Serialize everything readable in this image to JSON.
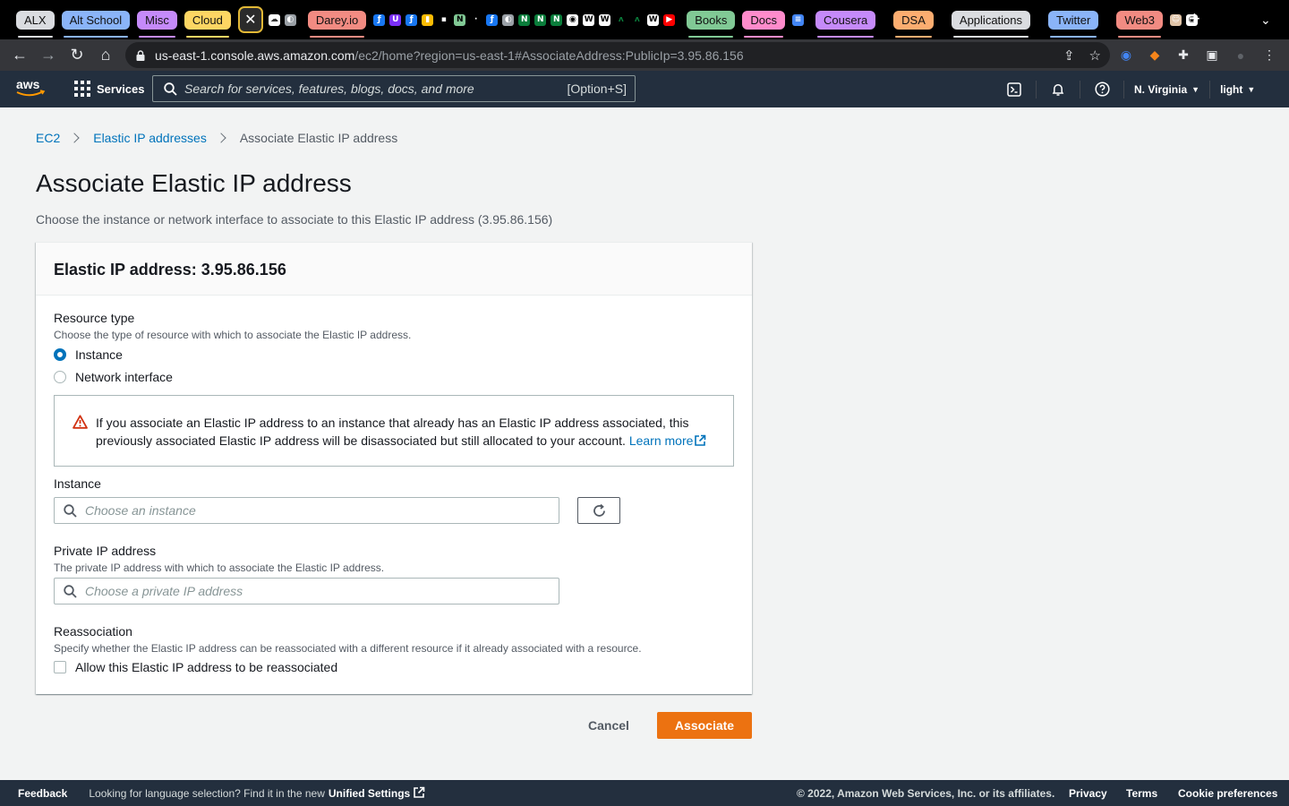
{
  "browser": {
    "tab_groups": [
      {
        "label": "ALX",
        "color": "#dadce0"
      },
      {
        "label": "Alt School",
        "color": "#8ab4f8"
      },
      {
        "label": "Misc",
        "color": "#c58af9"
      },
      {
        "label": "Cloud",
        "color": "#fdd663"
      },
      {
        "label": "Darey.io",
        "color": "#f28b82"
      },
      {
        "label": "Books",
        "color": "#81c995"
      },
      {
        "label": "Docs",
        "color": "#ff8bcb"
      },
      {
        "label": "Cousera",
        "color": "#c58af9"
      },
      {
        "label": "DSA",
        "color": "#fcad70"
      },
      {
        "label": "Applications",
        "color": "#dadce0"
      },
      {
        "label": "Twitter",
        "color": "#8ab4f8"
      },
      {
        "label": "Web3",
        "color": "#f28b82"
      }
    ],
    "active_tab_icon": "close-icon",
    "url_host": "us-east-1.console.aws.amazon.com",
    "url_path": "/ec2/home?region=us-east-1#AssociateAddress:PublicIp=3.95.86.156"
  },
  "aws_header": {
    "logo_text": "aws",
    "services_label": "Services",
    "search_placeholder": "Search for services, features, blogs, docs, and more",
    "search_shortcut": "[Option+S]",
    "region": "N. Virginia",
    "account": "light"
  },
  "breadcrumb": {
    "items": [
      "EC2",
      "Elastic IP addresses"
    ],
    "current": "Associate Elastic IP address"
  },
  "page": {
    "title": "Associate Elastic IP address",
    "description": "Choose the instance or network interface to associate to this Elastic IP address (3.95.86.156)"
  },
  "panel": {
    "header": "Elastic IP address: 3.95.86.156",
    "resource_type": {
      "label": "Resource type",
      "description": "Choose the type of resource with which to associate the Elastic IP address.",
      "options": [
        "Instance",
        "Network interface"
      ],
      "selected": "Instance"
    },
    "alert": {
      "text": "If you associate an Elastic IP address to an instance that already has an Elastic IP address associated, this previously associated Elastic IP address will be disassociated but still allocated to your account.",
      "link": "Learn more"
    },
    "instance": {
      "label": "Instance",
      "placeholder": "Choose an instance"
    },
    "private_ip": {
      "label": "Private IP address",
      "description": "The private IP address with which to associate the Elastic IP address.",
      "placeholder": "Choose a private IP address"
    },
    "reassociation": {
      "label": "Reassociation",
      "description": "Specify whether the Elastic IP address can be reassociated with a different resource if it already associated with a resource.",
      "checkbox_label": "Allow this Elastic IP address to be reassociated",
      "checked": false
    }
  },
  "actions": {
    "cancel": "Cancel",
    "associate": "Associate"
  },
  "footer": {
    "feedback": "Feedback",
    "language_text": "Looking for language selection? Find it in the new",
    "unified_settings": "Unified Settings",
    "copyright": "© 2022, Amazon Web Services, Inc. or its affiliates.",
    "privacy": "Privacy",
    "terms": "Terms",
    "cookies": "Cookie preferences"
  },
  "colors": {
    "primary_button": "#ec7211",
    "link": "#0073bb",
    "header_bg": "#232f3e"
  }
}
